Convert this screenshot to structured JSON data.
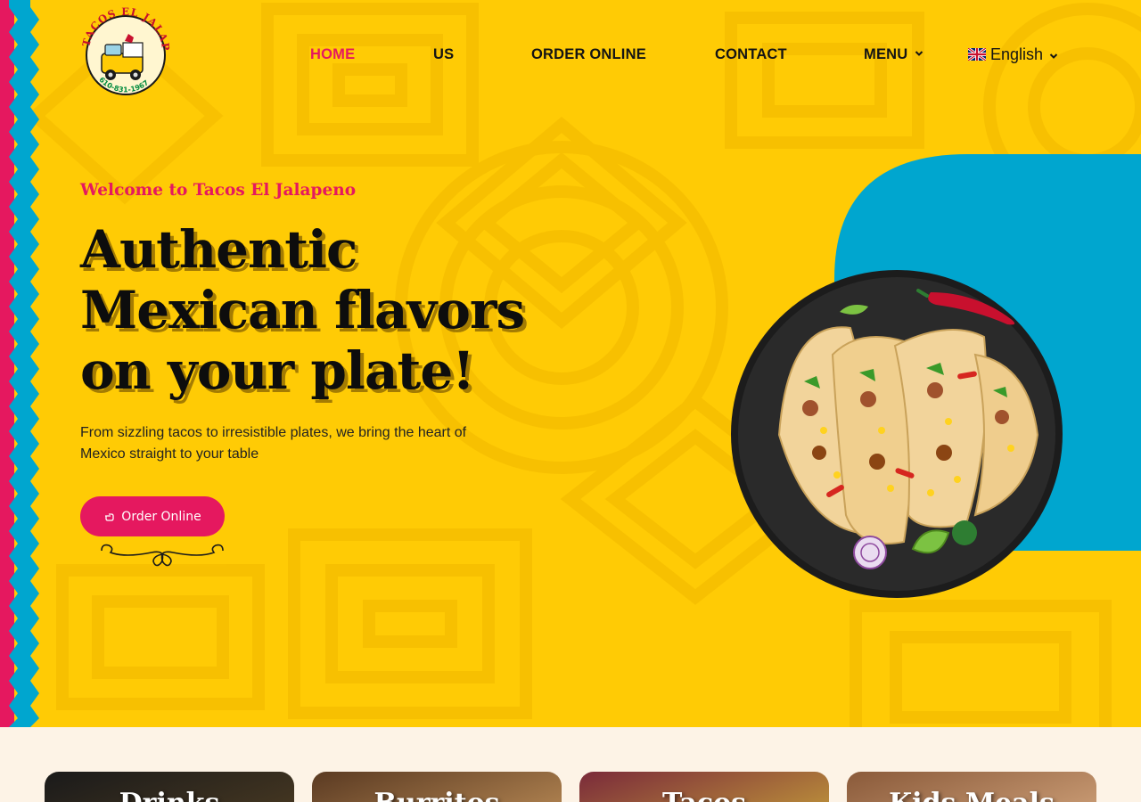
{
  "brand": {
    "logo_text": "TACOS EL JALAPENO",
    "logo_phone": "610-831-1967"
  },
  "nav": {
    "items": [
      {
        "label": "HOME",
        "active": true
      },
      {
        "label": "US",
        "active": false
      },
      {
        "label": "ORDER ONLINE",
        "active": false
      },
      {
        "label": "CONTACT",
        "active": false
      },
      {
        "label": "MENU",
        "active": false,
        "has_dropdown": true
      }
    ],
    "language": {
      "label": "English",
      "flag_icon": "uk-flag-icon"
    }
  },
  "hero": {
    "welcome": "Welcome to Tacos El Jalapeno",
    "headline_lines": [
      "Authentic",
      "Mexican flavors",
      "on your plate!"
    ],
    "subtext": "From sizzling tacos to irresistible plates, we bring the heart of Mexico straight to your table",
    "cta_label": "Order Online",
    "cta_icon": "hand-pointer-icon"
  },
  "categories": [
    {
      "label": "Drinks"
    },
    {
      "label": "Burritos"
    },
    {
      "label": "Tacos"
    },
    {
      "label": "Kids Meals"
    }
  ],
  "colors": {
    "hero_bg": "#ffcb05",
    "accent_pink": "#e5185f",
    "accent_blue": "#00a6cf",
    "text_dark": "#141414",
    "section_bg": "#fdf3e6"
  }
}
